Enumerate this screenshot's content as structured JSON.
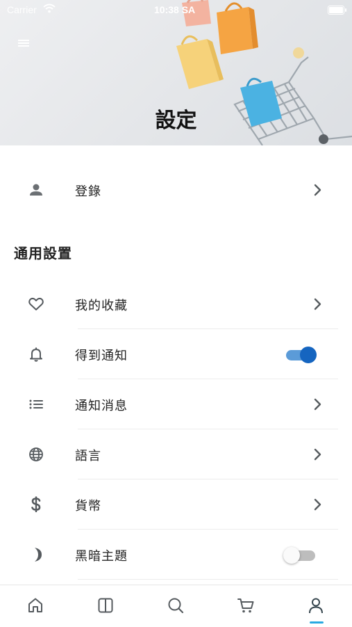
{
  "status_bar": {
    "carrier": "Carrier",
    "time": "10:38 SA"
  },
  "header": {
    "title": "設定"
  },
  "account": {
    "login_label": "登錄"
  },
  "general": {
    "section_title": "通用設置",
    "items": [
      {
        "label": "我的收藏",
        "icon": "heart-icon",
        "control": "chevron"
      },
      {
        "label": "得到通知",
        "icon": "bell-icon",
        "control": "toggle",
        "value": true
      },
      {
        "label": "通知消息",
        "icon": "list-icon",
        "control": "chevron"
      },
      {
        "label": "語言",
        "icon": "globe-icon",
        "control": "chevron"
      },
      {
        "label": "貨幣",
        "icon": "dollar-icon",
        "control": "chevron"
      },
      {
        "label": "黑暗主題",
        "icon": "moon-icon",
        "control": "toggle",
        "value": false
      }
    ]
  },
  "tabbar": {
    "tabs": [
      "home-icon",
      "catalog-icon",
      "search-icon",
      "cart-icon",
      "profile-icon"
    ],
    "active": "profile-icon"
  },
  "colors": {
    "accent": "#1565c0",
    "toggle_track_on": "#5b9bd8",
    "tab_indicator": "#29a9e1",
    "icon": "#555a5e"
  }
}
